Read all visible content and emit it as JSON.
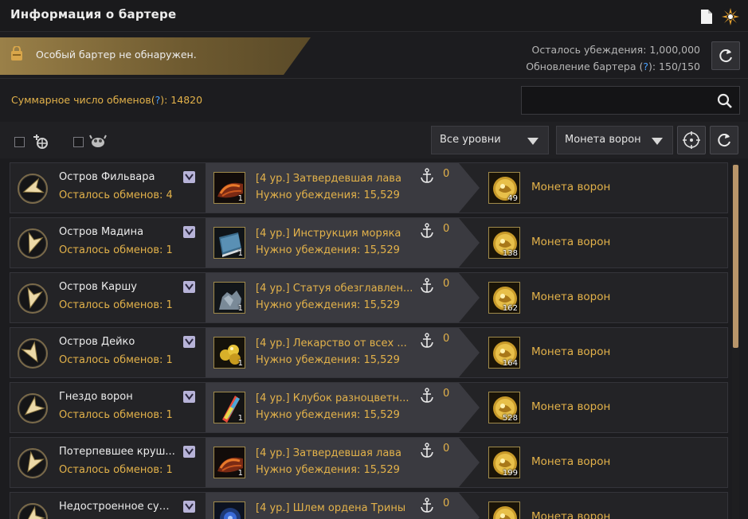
{
  "window": {
    "title": "Информация о бартере"
  },
  "icons": {
    "title_doc": "document-icon",
    "title_gear": "compass-gear-icon",
    "banner": "backpack-icon",
    "refresh": "refresh-icon",
    "search": "search-icon",
    "filter1": "ship-helm-icon",
    "filter2": "crab-icon",
    "locate": "crosshair-icon",
    "reset": "rotate-icon",
    "anchor": "anchor-icon"
  },
  "banner": {
    "text": "Особый бартер не обнаружен."
  },
  "info": {
    "persuasion_label": "Осталось убеждения: 1,000,000",
    "update_prefix": "Обновление бартера (",
    "update_q": "?",
    "update_suffix": "): 150/150"
  },
  "total": {
    "prefix": "Суммарное число обменов(",
    "q": "?",
    "suffix": "): 14820"
  },
  "search": {
    "value": "",
    "placeholder": ""
  },
  "filters": {
    "level": "Все уровни",
    "currency": "Монета ворон"
  },
  "rows": [
    {
      "location": "Остров Фильвара",
      "left": "Осталось обменов: 4",
      "item": "[4 ур.] Затвердевшая лава",
      "need": "Нужно убеждения: 15,529",
      "storage": "0",
      "give_count": "1",
      "get_count": "49",
      "get_name": "Монета ворон",
      "give_icon": "lava"
    },
    {
      "location": "Остров Мадина",
      "left": "Осталось обменов: 1",
      "item": "[4 ур.] Инструкция моряка",
      "need": "Нужно убеждения: 15,529",
      "storage": "0",
      "give_count": "1",
      "get_count": "138",
      "get_name": "Монета ворон",
      "give_icon": "book"
    },
    {
      "location": "Остров Каршу",
      "left": "Осталось обменов: 1",
      "item": "[4 ур.] Статуя обезглавлен...",
      "need": "Нужно убеждения: 15,529",
      "storage": "0",
      "give_count": "1",
      "get_count": "162",
      "get_name": "Монета ворон",
      "give_icon": "statue"
    },
    {
      "location": "Остров Дейко",
      "left": "Осталось обменов: 1",
      "item": "[4 ур.] Лекарство от всех ...",
      "need": "Нужно убеждения: 15,529",
      "storage": "0",
      "give_count": "1",
      "get_count": "164",
      "get_name": "Монета ворон",
      "give_icon": "pills"
    },
    {
      "location": "Гнездо ворон",
      "left": "Осталось обменов: 1",
      "item": "[4 ур.] Клубок разноцветн...",
      "need": "Нужно убеждения: 15,529",
      "storage": "0",
      "give_count": "1",
      "get_count": "528",
      "get_name": "Монета ворон",
      "give_icon": "yarn"
    },
    {
      "location": "Потерпевшее круш...",
      "left": "Осталось обменов: 1",
      "item": "[4 ур.] Затвердевшая лава",
      "need": "Нужно убеждения: 15,529",
      "storage": "0",
      "give_count": "1",
      "get_count": "199",
      "get_name": "Монета ворон",
      "give_icon": "lava"
    },
    {
      "location": "Недостроенное суд...",
      "left": "",
      "item": "[4 ур.] Шлем ордена Трины",
      "need": "",
      "storage": "0",
      "give_count": "",
      "get_count": "",
      "get_name": "Монета ворон",
      "give_icon": "helmet"
    }
  ],
  "colors": {
    "accent": "#e3b24a",
    "banner": "#8a7340",
    "question": "#4aa0ff"
  }
}
